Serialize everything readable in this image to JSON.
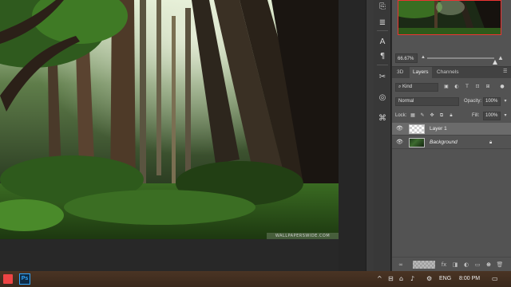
{
  "navigator": {
    "zoom_value": "66.67%"
  },
  "layers_panel": {
    "tabs": [
      {
        "label": "3D"
      },
      {
        "label": "Layers"
      },
      {
        "label": "Channels"
      }
    ],
    "filter_kind": "Kind",
    "blend_mode": "Normal",
    "opacity_label": "Opacity:",
    "opacity_value": "100%",
    "lock_label": "Lock:",
    "fill_label": "Fill:",
    "fill_value": "100%",
    "layers": [
      {
        "name": "Layer 1",
        "selected": true,
        "locked": false
      },
      {
        "name": "Background",
        "selected": false,
        "locked": true
      }
    ]
  },
  "canvas": {
    "watermark": "WALLPAPERSWIDE.COM"
  },
  "taskbar": {
    "apps": [
      {
        "name": "Windows Start",
        "icon": "windows-logo-icon"
      },
      {
        "name": "Photoshop",
        "icon": "photoshop-icon",
        "label": "Ps"
      }
    ],
    "language": "ENG",
    "clock": "8:00 PM"
  },
  "colors": {
    "panel_bg": "#535353",
    "selected_layer": "#6b6b6b",
    "navigator_frame": "#ee3333",
    "photoshop_blue": "#31a8ff"
  }
}
